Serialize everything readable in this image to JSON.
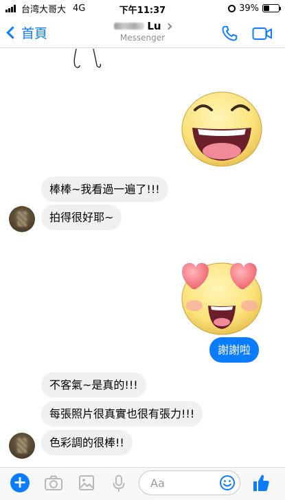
{
  "status_bar": {
    "carrier": "台湾大哥大",
    "network": "4G",
    "time": "下午11:37",
    "battery": "39%",
    "battery_level": 0.39
  },
  "header": {
    "back_label": "首頁",
    "contact_name_visible": "Lu",
    "subtitle": "Messenger",
    "icons": [
      "phone-icon",
      "video-camera-icon"
    ]
  },
  "messages": [
    {
      "side": "incoming",
      "text": "棒棒~我看過一遍了!!!"
    },
    {
      "side": "incoming",
      "text": "拍得很好耶~"
    },
    {
      "side": "outgoing",
      "text": "謝謝啦"
    },
    {
      "side": "incoming",
      "text": "不客氣~是真的!!!"
    },
    {
      "side": "incoming",
      "text": "每張照片很真實也很有張力!!!"
    },
    {
      "side": "incoming",
      "text": "色彩調的很棒!!"
    }
  ],
  "stickers": [
    "laughing-emoji-sticker",
    "heart-eyes-emoji-sticker"
  ],
  "composer": {
    "placeholder": "Aa",
    "tools": [
      "plus-icon",
      "camera-icon",
      "image-icon",
      "microphone-icon",
      "emoji-icon",
      "thumbs-up-icon"
    ],
    "accent": "#0a7cff"
  },
  "colors": {
    "accent": "#0a7cff",
    "incoming_bubble": "#f1f0f0",
    "outgoing_bubble": "#0a7cff"
  }
}
